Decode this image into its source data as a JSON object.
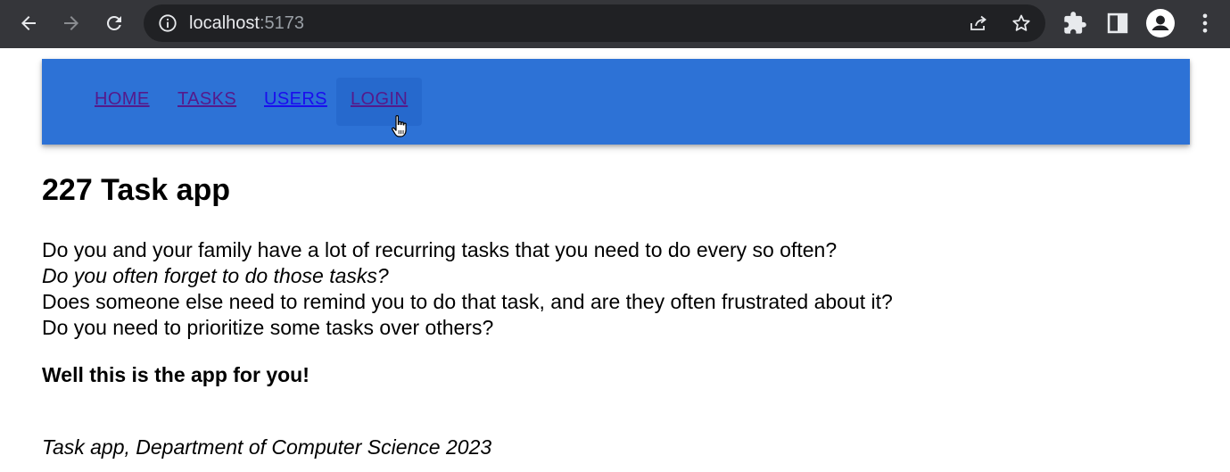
{
  "browser": {
    "url_host": "localhost",
    "url_port": ":5173",
    "icons": [
      "back-arrow-icon",
      "forward-arrow-icon",
      "reload-icon",
      "info-icon",
      "share-icon",
      "star-icon",
      "puzzle-icon",
      "sidepanel-icon",
      "profile-icon",
      "kebab-menu-icon"
    ]
  },
  "appbar": {
    "color": "#2d72d6",
    "links": [
      {
        "label": "HOME"
      },
      {
        "label": "TASKS"
      },
      {
        "label": "USERS"
      },
      {
        "label": "LOGIN"
      }
    ]
  },
  "main": {
    "title": "227 Task app",
    "lines": [
      "Do you and your family have a lot of recurring tasks that you need to do every so often?",
      "Do you often forget to do those tasks?",
      "Does someone else need to remind you to do that task, and are they often frustrated about it?",
      "Do you need to prioritize some tasks over others?"
    ],
    "callout": "Well this is the app for you!",
    "footer": "Task app, Department of Computer Science 2023"
  }
}
